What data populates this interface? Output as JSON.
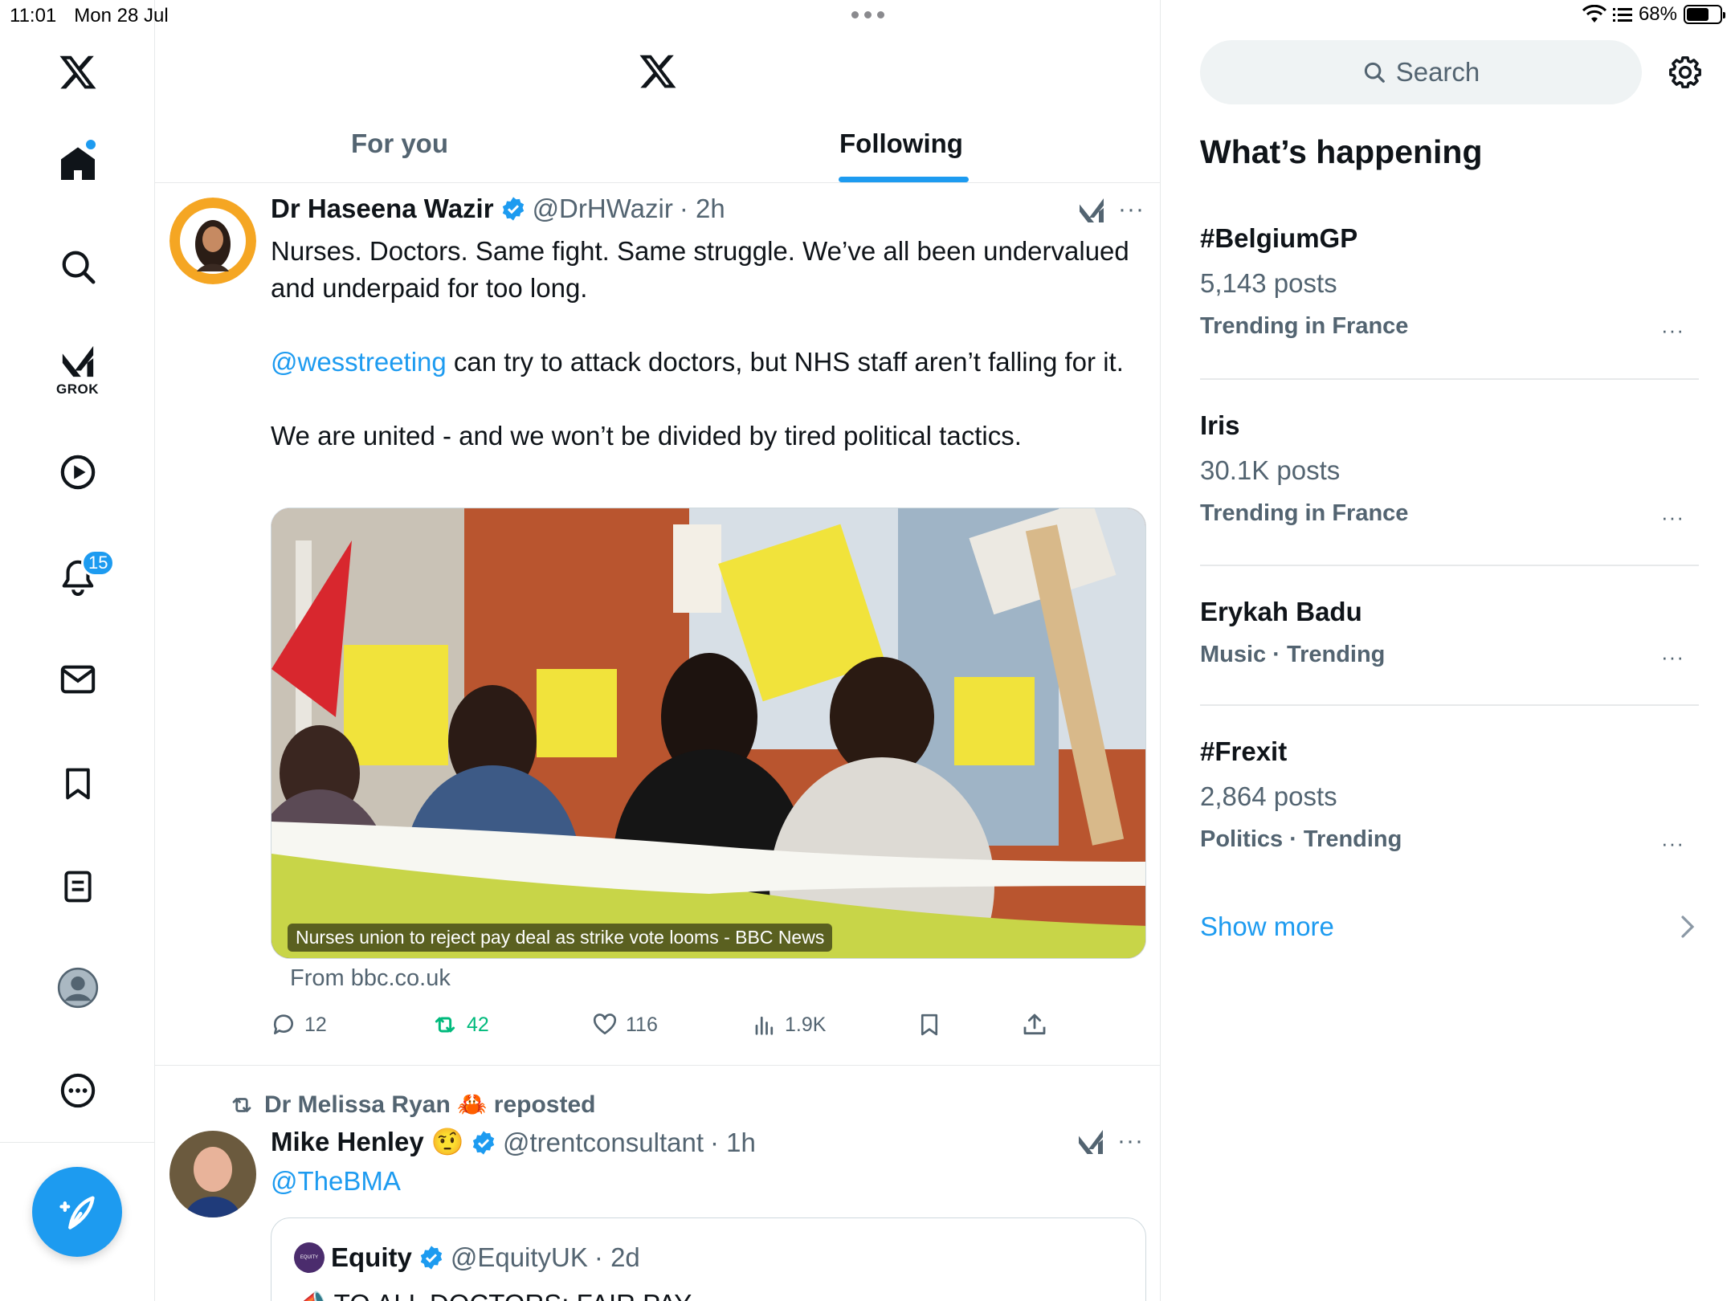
{
  "status_bar": {
    "time": "11:01",
    "date": "Mon 28 Jul",
    "battery": "68%",
    "battery_level": 0.68
  },
  "nav": {
    "grok_label": "GROK",
    "notifications_badge": "15"
  },
  "feed": {
    "tabs": {
      "for_you": "For you",
      "following": "Following"
    },
    "post1": {
      "name": "Dr Haseena Wazir",
      "handle": "@DrHWazir",
      "time": "· 2h",
      "para1": "Nurses. Doctors. Same fight. Same struggle. We’ve all been undervalued and underpaid for too long.",
      "mention": "@wesstreeting",
      "para2": " can try to attack doctors, but NHS staff aren’t falling for it.",
      "para3": "We are united - and we won’t be divided by tired political tactics.",
      "media_caption": "Nurses union to reject pay deal as strike vote looms - BBC News",
      "source": "From bbc.co.uk",
      "replies": "12",
      "reposts": "42",
      "likes": "116",
      "views": "1.9K"
    },
    "post2": {
      "repost_label": "Dr Melissa Ryan 🦀 reposted",
      "name": "Mike Henley 🤨",
      "handle": "@trentconsultant",
      "time": "· 1h",
      "text": "@TheBMA",
      "quote": {
        "avatar_text": "EQUITY",
        "name": "Equity",
        "handle": "@EquityUK",
        "time": "· 2d",
        "text": "📣 TO ALL DOCTORS: FAIR PAY"
      }
    }
  },
  "sidebar": {
    "search_placeholder": "Search",
    "title": "What’s happening",
    "trends": [
      {
        "name": "#BelgiumGP",
        "posts": "5,143 posts",
        "context": "Trending in France"
      },
      {
        "name": "Iris",
        "posts": "30.1K posts",
        "context": "Trending in France"
      },
      {
        "name": "Erykah Badu",
        "context": "Music · Trending"
      },
      {
        "name": "#Frexit",
        "posts": "2,864 posts",
        "context": "Politics · Trending"
      }
    ],
    "show_more": "Show more"
  },
  "colors": {
    "accent": "#1d9bf0",
    "repost_green": "#00ba7c",
    "secondary_text": "#536471"
  }
}
